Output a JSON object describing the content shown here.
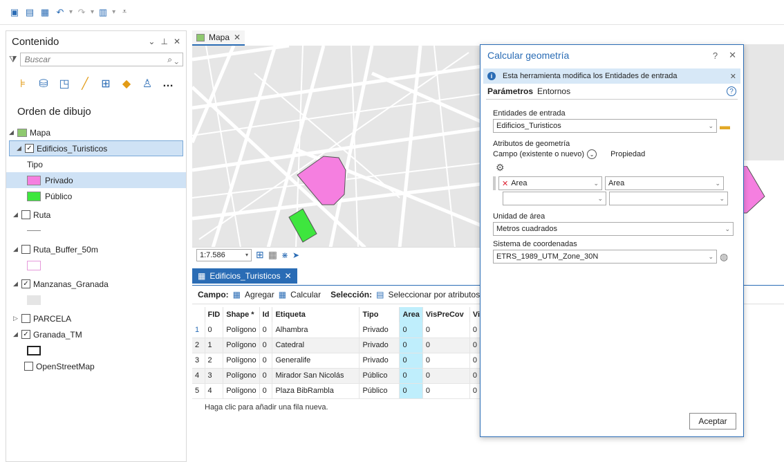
{
  "contents": {
    "title": "Contenido",
    "search_placeholder": "Buscar",
    "drawing_order": "Orden de dibujo",
    "layers": {
      "map": "Mapa",
      "edificios": "Edificios_Turisticos",
      "tipo_label": "Tipo",
      "privado": "Privado",
      "publico": "Público",
      "ruta": "Ruta",
      "ruta_buffer": "Ruta_Buffer_50m",
      "manzanas": "Manzanas_Granada",
      "parcela": "PARCELA",
      "granada_tm": "Granada_TM",
      "osm": "OpenStreetMap"
    },
    "colors": {
      "privado": "#f57fe0",
      "publico": "#3ee63e"
    }
  },
  "map": {
    "tab": "Mapa",
    "scale": "1:7.586"
  },
  "table": {
    "tab": "Edificios_Turisticos",
    "campo_label": "Campo:",
    "agregar": "Agregar",
    "calcular": "Calcular",
    "seleccion_label": "Selección:",
    "seleccionar": "Seleccionar por atributos",
    "columns": [
      "FID",
      "Shape *",
      "Id",
      "Etiqueta",
      "Tipo",
      "Area",
      "VisPreCov",
      "VisC"
    ],
    "rows": [
      {
        "n": "1",
        "fid": "0",
        "shape": "Polígono",
        "id": "0",
        "etiqueta": "Alhambra",
        "tipo": "Privado",
        "area": "0",
        "vis": "0",
        "visc": "0"
      },
      {
        "n": "2",
        "fid": "1",
        "shape": "Polígono",
        "id": "0",
        "etiqueta": "Catedral",
        "tipo": "Privado",
        "area": "0",
        "vis": "0",
        "visc": "0"
      },
      {
        "n": "3",
        "fid": "2",
        "shape": "Polígono",
        "id": "0",
        "etiqueta": "Generalife",
        "tipo": "Privado",
        "area": "0",
        "vis": "0",
        "visc": "0"
      },
      {
        "n": "4",
        "fid": "3",
        "shape": "Polígono",
        "id": "0",
        "etiqueta": "Mirador San Nicolás",
        "tipo": "Público",
        "area": "0",
        "vis": "0",
        "visc": "0"
      },
      {
        "n": "5",
        "fid": "4",
        "shape": "Polígono",
        "id": "0",
        "etiqueta": "Plaza BibRambla",
        "tipo": "Público",
        "area": "0",
        "vis": "0",
        "visc": "0"
      }
    ],
    "add_row": "Haga clic para añadir una fila nueva."
  },
  "dialog": {
    "title": "Calcular geometría",
    "help": "?",
    "info": "Esta herramienta modifica los Entidades de entrada",
    "tab_params": "Parámetros",
    "tab_env": "Entornos",
    "input_label": "Entidades de entrada",
    "input_value": "Edificios_Turisticos",
    "geom_attrs": "Atributos de geometría",
    "campo_hdr": "Campo (existente o nuevo)",
    "prop_hdr": "Propiedad",
    "attr_field": "Area",
    "attr_prop": "Area",
    "unit_label": "Unidad de área",
    "unit_value": "Metros cuadrados",
    "crs_label": "Sistema de coordenadas",
    "crs_value": "ETRS_1989_UTM_Zone_30N",
    "accept": "Aceptar"
  }
}
